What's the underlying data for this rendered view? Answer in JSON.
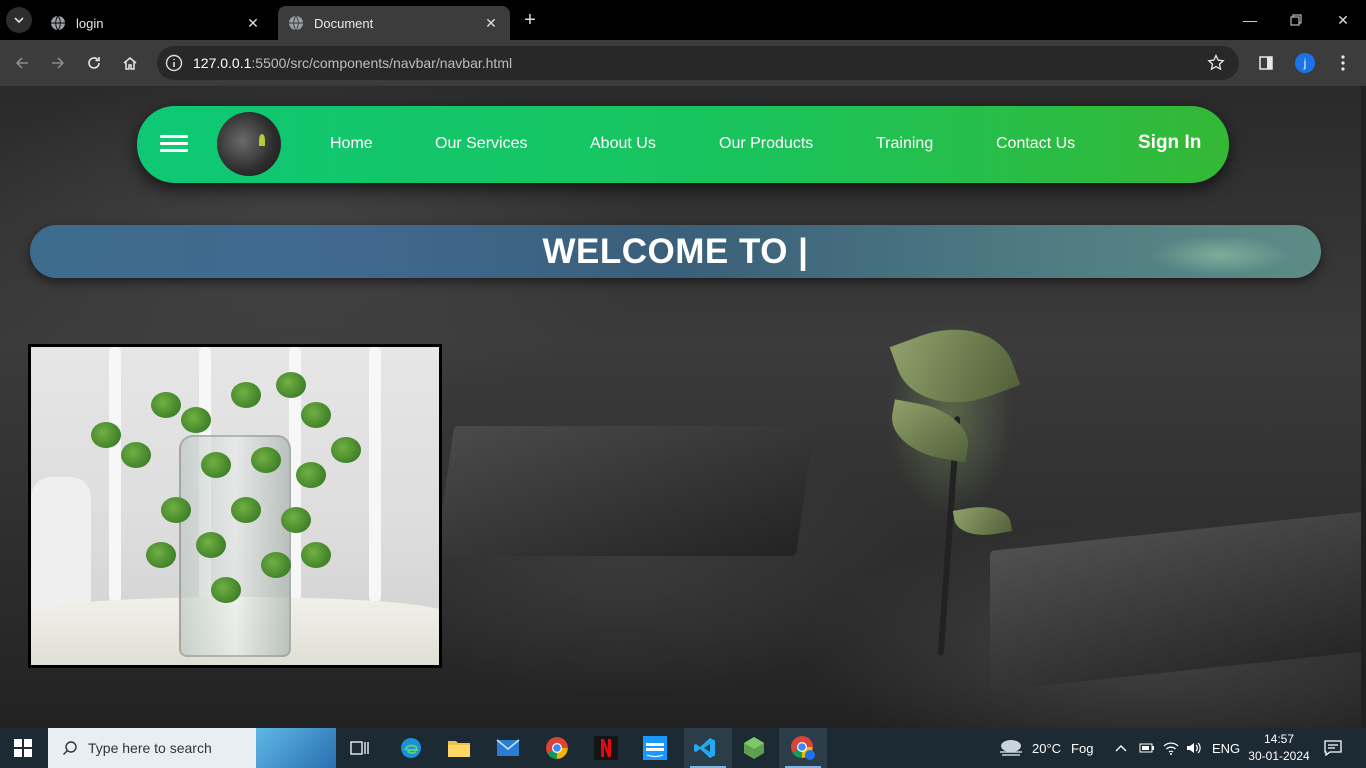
{
  "browser": {
    "tabs": [
      {
        "title": "login",
        "active": false
      },
      {
        "title": "Document",
        "active": true
      }
    ],
    "address": {
      "host": "127.0.0.1",
      "rest": ":5500/src/components/navbar/navbar.html"
    },
    "profile_initial": "j"
  },
  "navbar": {
    "links": [
      "Home",
      "Our Services",
      "About Us",
      "Our Products",
      "Training",
      "Contact Us"
    ],
    "signin_label": "Sign In",
    "brand_color_start": "#0ec875",
    "brand_color_end": "#34b836"
  },
  "hero": {
    "welcome_text": "WELCOME TO |"
  },
  "taskbar": {
    "search_placeholder": "Type here to search",
    "weather_temp": "20°C",
    "weather_desc": "Fog",
    "language": "ENG",
    "time": "14:57",
    "date": "30-01-2024",
    "apps": [
      "task-view-icon",
      "edge-icon",
      "file-explorer-icon",
      "mail-icon",
      "chrome-icon",
      "netflix-icon",
      "prime-video-icon",
      "vscode-icon",
      "nodejs-icon",
      "chrome-profile-icon"
    ]
  }
}
